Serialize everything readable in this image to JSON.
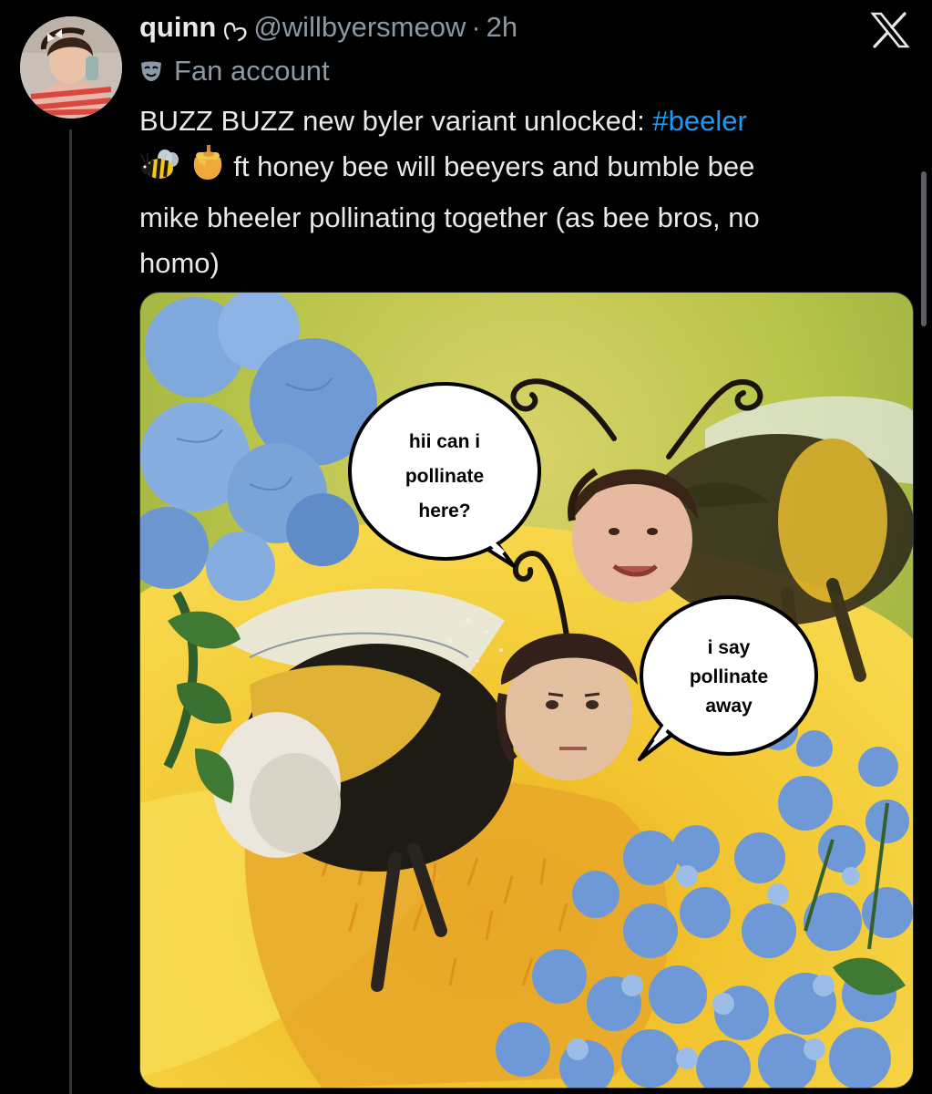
{
  "tweet": {
    "display_name": "quinn",
    "name_symbol": "ᢉ𐭩",
    "handle": "@willbyersmeow",
    "separator": "·",
    "time": "2h",
    "label": "Fan account",
    "text_line1": "BUZZ BUZZ new byler variant unlocked: ",
    "hashtag": "#beeler",
    "text_line2": "ft honey bee will beeyers and bumble bee",
    "text_line3": "mike bheeler pollinating together (as bee bros, no",
    "text_line4": "homo)"
  },
  "icons": {
    "close": "x-close-icon",
    "label": "mask-icon",
    "emoji1": "bee-icon",
    "emoji2": "honey-pot-icon"
  },
  "image": {
    "bubble_left_line1": "hii can i",
    "bubble_left_line2": "pollinate",
    "bubble_left_line3": "here?",
    "bubble_right_line1": "i say",
    "bubble_right_line2": "pollinate",
    "bubble_right_line3": "away"
  },
  "colors": {
    "background": "#000000",
    "text": "#e7e9ea",
    "secondary": "#8b98a5",
    "link": "#1d9bf0"
  }
}
